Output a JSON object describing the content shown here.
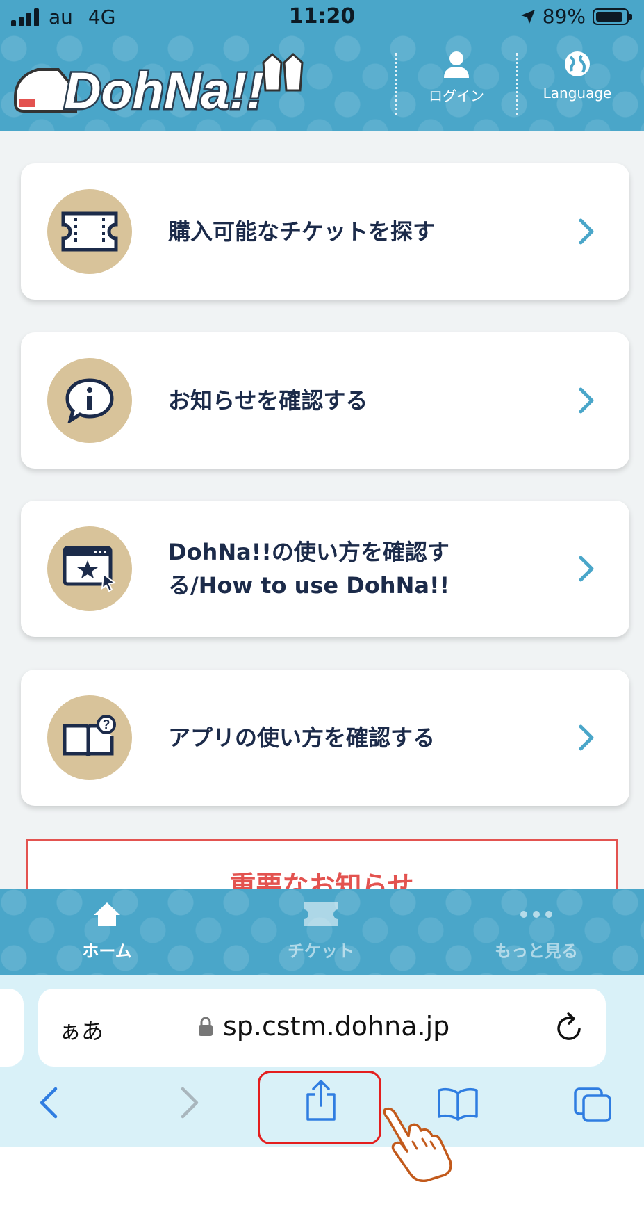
{
  "status_bar": {
    "carrier": "au",
    "network": "4G",
    "time": "11:20",
    "battery": "89%"
  },
  "header": {
    "logo_text": "DohNa!!",
    "login_label": "ログイン",
    "language_label": "Language"
  },
  "menu_items": [
    {
      "label": "購入可能なチケットを探す",
      "icon": "ticket-icon"
    },
    {
      "label": "お知らせを確認する",
      "icon": "info-speech-icon"
    },
    {
      "label": "DohNa!!の使い方を確認する/How to use DohNa!!",
      "icon": "browser-star-icon"
    },
    {
      "label": "アプリの使い方を確認する",
      "icon": "book-question-icon"
    }
  ],
  "notice": {
    "label": "重要なお知らせ"
  },
  "tab_bar": {
    "home": "ホーム",
    "ticket": "チケット",
    "more": "もっと見る"
  },
  "safari": {
    "aa_label": "ぁあ",
    "url": "sp.cstm.dohna.jp"
  },
  "colors": {
    "brand": "#4aa6c9",
    "icon_circle": "#d8c39a",
    "text_dark": "#1c2b4a",
    "alert": "#e35350",
    "safari_blue": "#2f7de1"
  }
}
